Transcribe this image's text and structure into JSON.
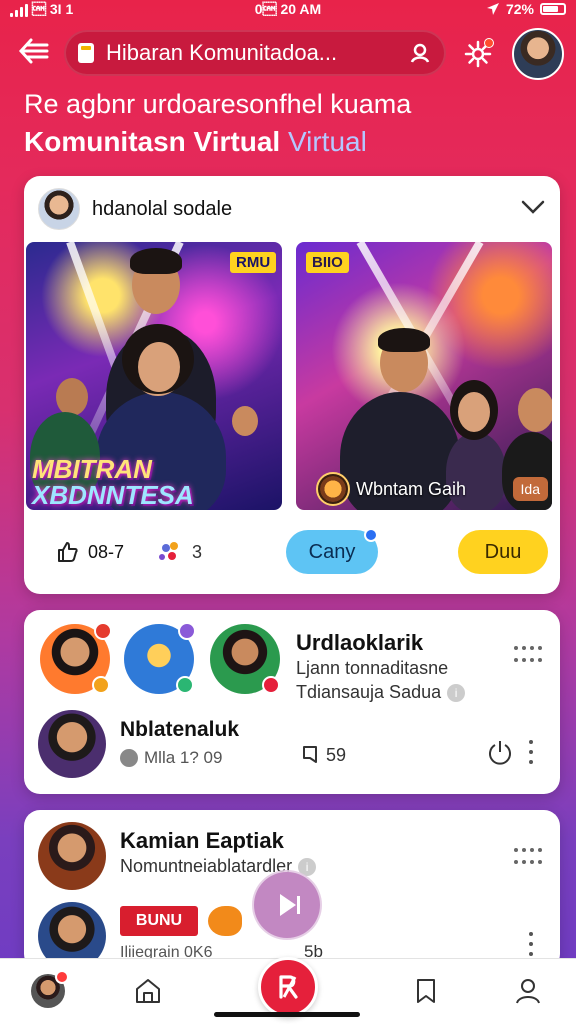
{
  "status_bar": {
    "left": "\u0018 3I 1",
    "time": "0\u0018 20 AM",
    "battery": "72%"
  },
  "header": {
    "search_text": "Hibaran Komunitadoa...",
    "headline_line1": "Re agbnr urdoaresonfhel kuama",
    "headline_line2_bold": "Komunitasn Virtual",
    "headline_line2_accent": "Virtual"
  },
  "post_card": {
    "author": "hdanolal sodale",
    "left_media": {
      "badge": "RMU",
      "caption_line1": "MBITRAN",
      "caption_line2": "XBDNNTESA"
    },
    "right_media": {
      "badge": "BIIO",
      "caption": "Wbntam Gaih",
      "chip": "Ida"
    },
    "like_count": "08-7",
    "reaction_count": "3",
    "primary_button": "Cany",
    "secondary_button": "Duu"
  },
  "community_card": {
    "title": "Urdlaoklarik",
    "subtitle1": "Ljann tonnaditasne",
    "subtitle2": "Tdiansauja Sadua",
    "stories": [
      {
        "name": "story-1",
        "badge_color": "#e53b2e"
      },
      {
        "name": "story-2",
        "badge_color": "#2bb673"
      },
      {
        "name": "story-3",
        "badge_color": "#e5203b"
      }
    ],
    "user_name": "Nblatenaluk",
    "user_meta": "Mlla 1? 09",
    "comment_count": "59"
  },
  "third_card": {
    "title": "Kamian Eaptiak",
    "subtitle": "Nomuntneiablatardler",
    "tag": "BUNU",
    "meta": "Iliiegrain 0K6",
    "count": "5b"
  },
  "colors": {
    "accent_red": "#e5203b",
    "button_blue": "#5ec4f4",
    "button_yellow": "#ffd21f"
  },
  "icons": [
    "back-icon",
    "document-icon",
    "user-icon",
    "gear-icon",
    "chevron-down-icon",
    "thumbs-up-icon",
    "reaction-icon",
    "more-icon",
    "comment-icon",
    "power-icon",
    "play-icon",
    "home-icon",
    "bookmark-icon",
    "profile-icon"
  ]
}
